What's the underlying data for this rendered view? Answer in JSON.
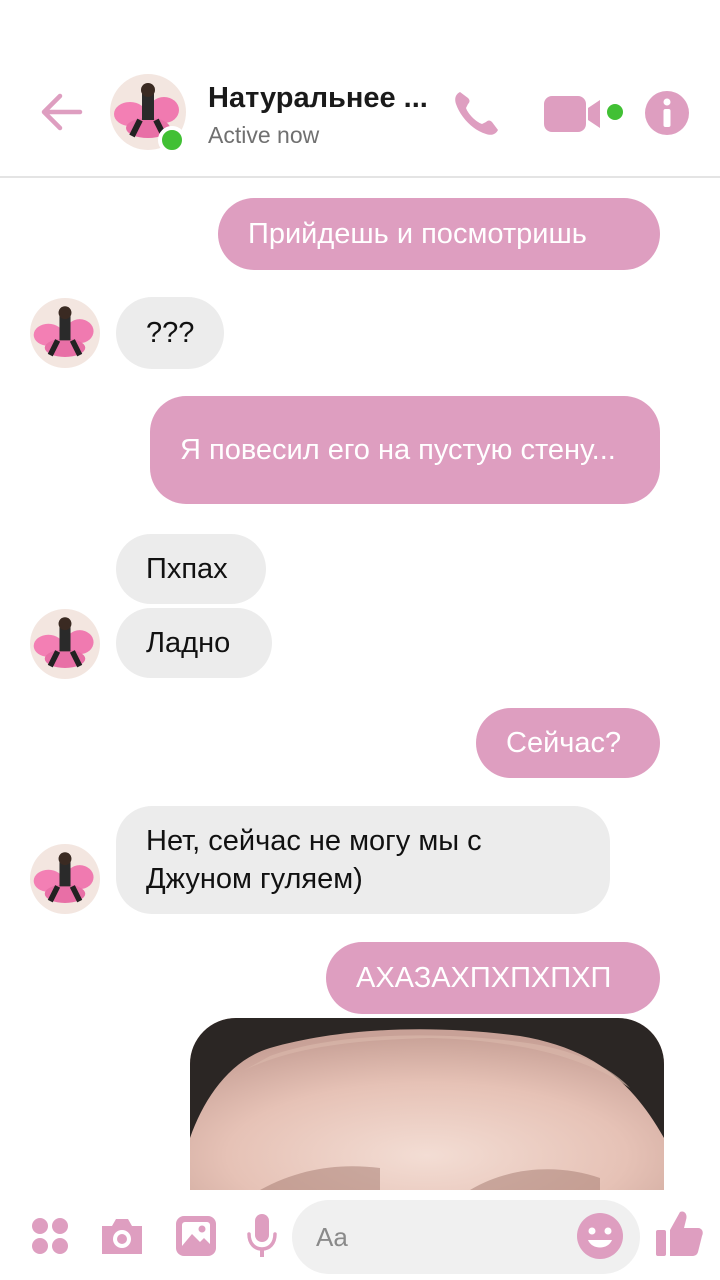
{
  "header": {
    "name": "Натуральнее ...",
    "status": "Active now"
  },
  "messages": [
    {
      "side": "out",
      "text": "Прийдешь и посмотришь"
    },
    {
      "side": "in",
      "text": "???"
    },
    {
      "side": "out",
      "text": "Я повесил его на пустую стену..."
    },
    {
      "side": "in",
      "text": "Пхпах"
    },
    {
      "side": "in",
      "text": "Ладно"
    },
    {
      "side": "out",
      "text": "Сейчас?"
    },
    {
      "side": "in",
      "text": "Нет, сейчас не могу мы с Джуном гуляем)"
    },
    {
      "side": "out",
      "text": "АХАЗАХПХПХПХП"
    }
  ],
  "composer": {
    "placeholder": "Aa"
  },
  "colors": {
    "accent": "#de9ec0",
    "incoming_bubble": "#ececec",
    "online": "#41c034"
  },
  "icons": [
    "back-arrow-icon",
    "phone-icon",
    "video-camera-icon",
    "info-icon",
    "apps-icon",
    "camera-icon",
    "gallery-icon",
    "microphone-icon",
    "emoji-icon",
    "thumbs-up-icon"
  ]
}
